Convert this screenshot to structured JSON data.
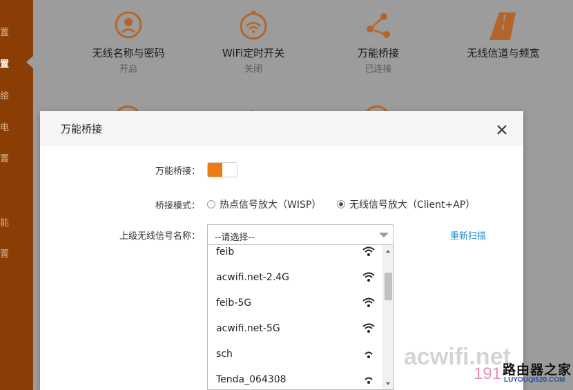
{
  "sidebar": {
    "items": [
      {
        "label": "置",
        "active": false
      },
      {
        "label": "置",
        "active": true
      },
      {
        "label": "络",
        "active": false
      },
      {
        "label": "电",
        "active": false
      },
      {
        "label": "置",
        "active": false
      },
      {
        "label": "能",
        "active": false
      },
      {
        "label": "置",
        "active": false
      }
    ]
  },
  "features": [
    {
      "title": "无线名称与密码",
      "sub": "开启",
      "icon": "wireless-password-icon"
    },
    {
      "title": "WiFi定时开关",
      "sub": "关闭",
      "icon": "wifi-timer-icon"
    },
    {
      "title": "万能桥接",
      "sub": "已连接",
      "icon": "bridge-icon"
    },
    {
      "title": "无线信道与频宽",
      "sub": "",
      "icon": "channel-road-icon"
    }
  ],
  "modal": {
    "title": "万能桥接",
    "bridge_label": "万能桥接：",
    "bridge_enabled": true,
    "mode_label": "桥接模式：",
    "mode_options": [
      {
        "label": "热点信号放大（WISP）",
        "checked": false
      },
      {
        "label": "无线信号放大（Client+AP）",
        "checked": true
      }
    ],
    "ssid_label": "上级无线信号名称：",
    "select_value": "--请选择--",
    "rescan_label": "重新扫描",
    "networks": [
      {
        "ssid": "feib"
      },
      {
        "ssid": "acwifi.net-2.4G"
      },
      {
        "ssid": "feib-5G"
      },
      {
        "ssid": "acwifi.net-5G"
      },
      {
        "ssid": "sch"
      },
      {
        "ssid": "Tenda_064308"
      }
    ]
  },
  "watermark": {
    "site": "acwifi.net",
    "brand_cn": "路由器之家",
    "brand_url": "LUYOUQI520.COM",
    "number": "191"
  },
  "colors": {
    "accent": "#ee7a13",
    "sidebar": "#8a3e05",
    "link": "#1f8fc4"
  }
}
